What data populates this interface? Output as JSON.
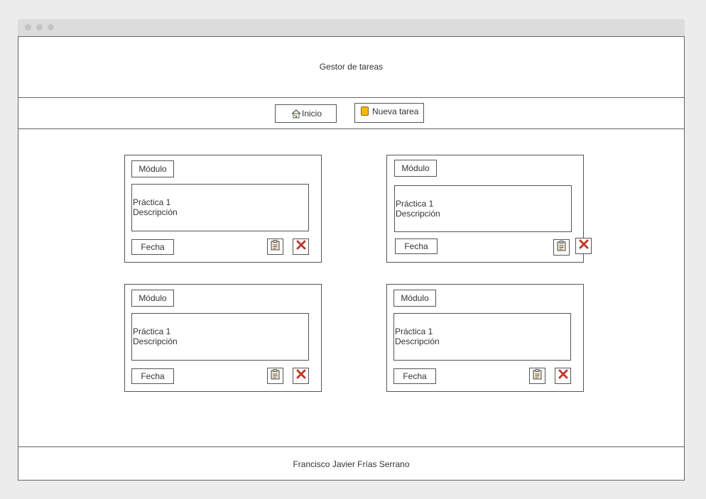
{
  "app": {
    "title": "Gestor de tareas"
  },
  "nav": {
    "home_label": "Inicio",
    "new_task_label": "Nueva tarea"
  },
  "cards": [
    {
      "module": "Módulo",
      "title": "Práctica 1",
      "description": "Descripción",
      "date": "Fecha"
    },
    {
      "module": "Módulo",
      "title": "Práctica 1",
      "description": "Descripción",
      "date": "Fecha"
    },
    {
      "module": "Módulo",
      "title": "Práctica 1",
      "description": "Descripción",
      "date": "Fecha"
    },
    {
      "module": "Módulo",
      "title": "Práctica 1",
      "description": "Descripción",
      "date": "Fecha"
    }
  ],
  "footer": {
    "author": "Francisco Javier Frías Serrano"
  },
  "icons": {
    "home": "home-icon",
    "new_task": "note-icon",
    "edit": "clipboard-icon",
    "delete": "close-icon"
  },
  "colors": {
    "delete_red": "#c0392b",
    "note_yellow": "#f5b800"
  }
}
